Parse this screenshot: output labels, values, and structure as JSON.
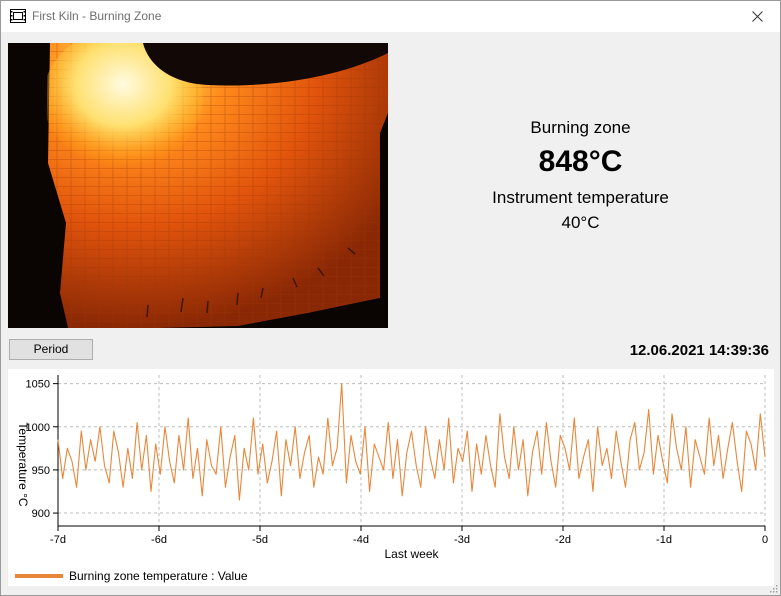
{
  "window": {
    "title": "First Kiln - Burning Zone"
  },
  "readouts": {
    "zone_label": "Burning zone",
    "zone_value": "848°C",
    "instrument_label": "Instrument temperature",
    "instrument_value": "40°C"
  },
  "controls": {
    "period_label": "Period",
    "datetime": "12.06.2021 14:39:36"
  },
  "chart_data": {
    "type": "line",
    "xlabel": "Last week",
    "ylabel": "Temperature °C",
    "x_ticks": [
      "-7d",
      "-6d",
      "-5d",
      "-4d",
      "-3d",
      "-2d",
      "-1d",
      "0"
    ],
    "y_ticks": [
      1050,
      1000,
      950,
      900
    ],
    "xlim": [
      -7,
      0
    ],
    "ylim": [
      885,
      1060
    ],
    "grid": true,
    "legend_position": "bottom-left",
    "series": [
      {
        "name": "Burning zone temperature : Value",
        "color": "#e8873a",
        "y": [
          985,
          940,
          975,
          960,
          930,
          995,
          950,
          985,
          960,
          1000,
          955,
          935,
          995,
          970,
          930,
          975,
          940,
          1005,
          950,
          990,
          925,
          980,
          945,
          1000,
          960,
          935,
          990,
          950,
          1010,
          940,
          975,
          920,
          985,
          955,
          945,
          1000,
          930,
          965,
          990,
          915,
          975,
          950,
          1010,
          945,
          980,
          935,
          960,
          995,
          920,
          985,
          955,
          1000,
          940,
          970,
          990,
          930,
          965,
          945,
          1010,
          955,
          975,
          1050,
          935,
          990,
          960,
          945,
          1000,
          925,
          980,
          965,
          950,
          1005,
          940,
          985,
          920,
          970,
          995,
          955,
          930,
          1000,
          965,
          940,
          985,
          950,
          1010,
          935,
          975,
          960,
          995,
          925,
          980,
          945,
          990,
          955,
          930,
          1015,
          965,
          940,
          1000,
          950,
          985,
          920,
          970,
          995,
          945,
          1005,
          960,
          930,
          990,
          975,
          950,
          1010,
          940,
          965,
          985,
          925,
          1000,
          955,
          975,
          940,
          995,
          960,
          930,
          985,
          1005,
          950,
          970,
          1020,
          945,
          990,
          960,
          935,
          1015,
          975,
          950,
          1000,
          930,
          985,
          965,
          945,
          1010,
          955,
          990,
          940,
          975,
          1005,
          960,
          925,
          995,
          980,
          950,
          1015,
          965
        ]
      }
    ]
  }
}
